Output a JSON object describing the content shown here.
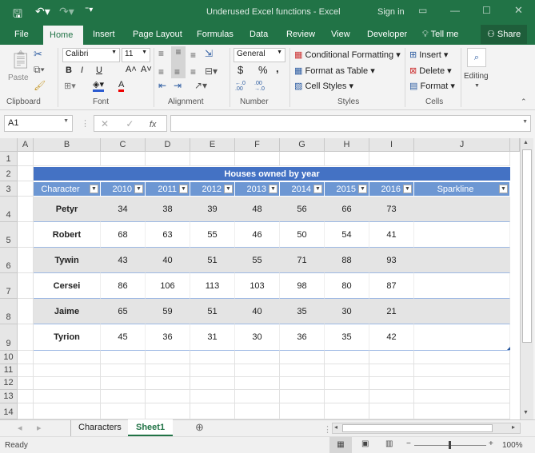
{
  "window": {
    "title": "Underused Excel functions - Excel",
    "sign_in": "Sign in"
  },
  "ribbon_tabs": [
    "File",
    "Home",
    "Insert",
    "Page Layout",
    "Formulas",
    "Data",
    "Review",
    "View",
    "Developer",
    "Tell me"
  ],
  "share": "Share",
  "clipboard": {
    "paste": "Paste",
    "label": "Clipboard"
  },
  "font": {
    "name": "Calibri",
    "size": "11",
    "label": "Font",
    "bold": "B",
    "italic": "I",
    "underline": "U",
    "font_color": "A"
  },
  "alignment": {
    "label": "Alignment"
  },
  "number": {
    "format": "General",
    "currency": "$",
    "percent": "%",
    "comma": ",",
    "label": "Number",
    "inc": "←.0 .00",
    "dec": ".00 →.0"
  },
  "styles": {
    "conditional": "Conditional Formatting",
    "format_table": "Format as Table",
    "cell_styles": "Cell Styles",
    "label": "Styles"
  },
  "cells": {
    "insert": "Insert",
    "delete": "Delete",
    "format": "Format",
    "label": "Cells"
  },
  "editing": {
    "label": "Editing"
  },
  "formula_bar": {
    "name_box": "A1",
    "fx": "fx",
    "cancel": "✕",
    "enter": "✓",
    "value": ""
  },
  "columns": [
    "A",
    "B",
    "C",
    "D",
    "E",
    "F",
    "G",
    "H",
    "I",
    "J"
  ],
  "rows": [
    "1",
    "2",
    "3",
    "4",
    "5",
    "6",
    "7",
    "8",
    "9",
    "10",
    "11",
    "12",
    "13",
    "14"
  ],
  "table": {
    "title": "Houses owned by year",
    "headers": [
      "Character",
      "2010",
      "2011",
      "2012",
      "2013",
      "2014",
      "2015",
      "2016",
      "Sparkline"
    ],
    "data": [
      [
        "Petyr",
        "34",
        "38",
        "39",
        "48",
        "56",
        "66",
        "73"
      ],
      [
        "Robert",
        "68",
        "63",
        "55",
        "46",
        "50",
        "54",
        "41"
      ],
      [
        "Tywin",
        "43",
        "40",
        "51",
        "55",
        "71",
        "88",
        "93"
      ],
      [
        "Cersei",
        "86",
        "106",
        "113",
        "103",
        "98",
        "80",
        "87"
      ],
      [
        "Jaime",
        "65",
        "59",
        "51",
        "40",
        "35",
        "30",
        "21"
      ],
      [
        "Tyrion",
        "45",
        "36",
        "31",
        "30",
        "36",
        "35",
        "42"
      ]
    ]
  },
  "sheets": [
    "Characters",
    "Sheet1"
  ],
  "active_sheet": "Sheet1",
  "status": {
    "ready": "Ready",
    "zoom": "100%"
  },
  "colors": {
    "brand": "#217346",
    "title_row": "#4472c4",
    "header_row": "#6d97d3",
    "band": "#e4e4e4"
  }
}
